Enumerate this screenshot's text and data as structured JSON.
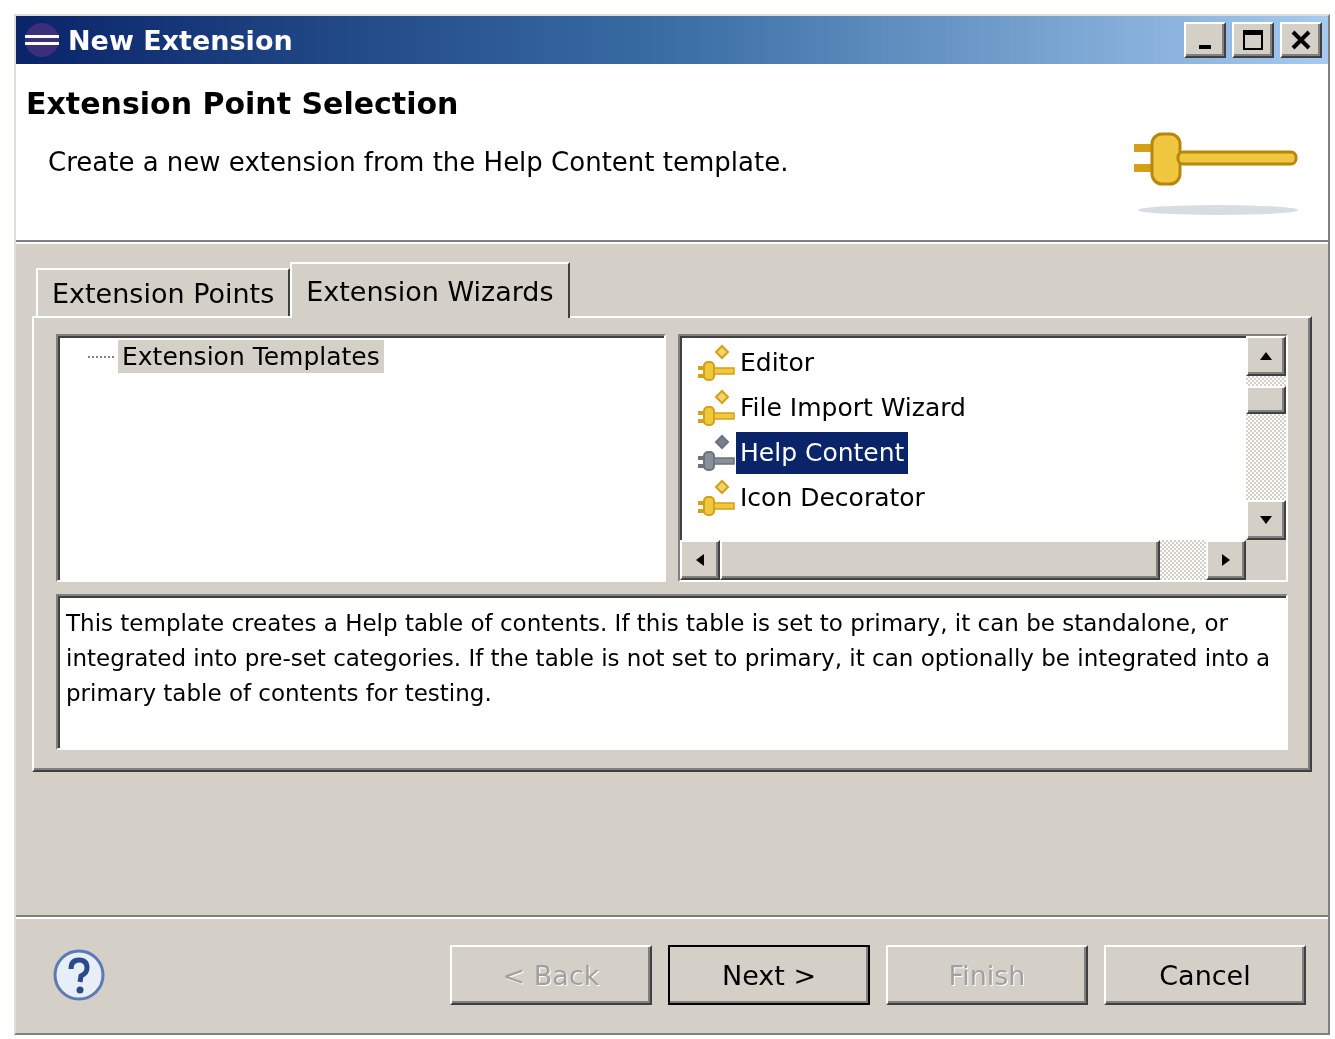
{
  "window": {
    "title": "New Extension"
  },
  "header": {
    "title": "Extension Point Selection",
    "description": "Create a new extension from the Help Content template."
  },
  "tabs": [
    {
      "label": "Extension Points",
      "selected": false
    },
    {
      "label": "Extension Wizards",
      "selected": true
    }
  ],
  "templates_tree": {
    "items": [
      {
        "label": "Extension Templates",
        "selected": true
      }
    ]
  },
  "wizards_list": {
    "items": [
      {
        "label": "Editor",
        "selected": false
      },
      {
        "label": "File Import Wizard",
        "selected": false
      },
      {
        "label": "Help Content",
        "selected": true
      },
      {
        "label": "Icon Decorator",
        "selected": false
      }
    ]
  },
  "description": "This template creates a Help table of contents. If this table is set to primary, it can be standalone, or integrated into pre-set categories. If the table is not set to primary, it can optionally be integrated into a primary table of contents for testing.",
  "buttons": [
    {
      "label": "< Back",
      "disabled": true,
      "default": false
    },
    {
      "label": "Next >",
      "disabled": false,
      "default": true
    },
    {
      "label": "Finish",
      "disabled": true,
      "default": false
    },
    {
      "label": "Cancel",
      "disabled": false,
      "default": false
    }
  ]
}
